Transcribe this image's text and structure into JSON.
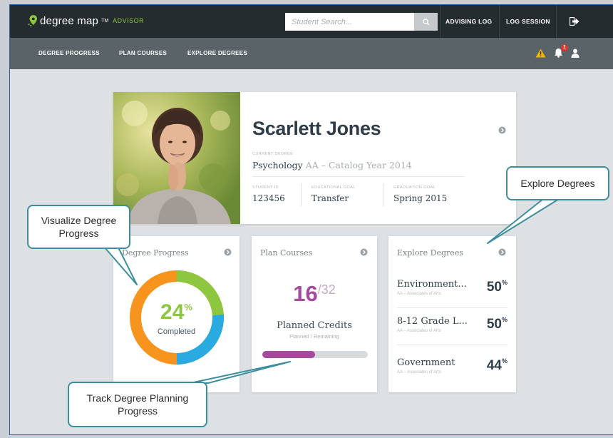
{
  "app": {
    "brand": "degree map",
    "tm": "TM",
    "edition": "ADVISOR"
  },
  "search": {
    "placeholder": "Student Search..."
  },
  "topnav": {
    "advising_log": "ADVISING LOG",
    "log_session": "LOG SESSION"
  },
  "subnav": {
    "items": [
      "DEGREE PROGRESS",
      "PLAN COURSES",
      "EXPLORE DEGREES"
    ],
    "notification_count": "1"
  },
  "student": {
    "name": "Scarlett Jones",
    "current_degree_label": "CURRENT DEGREE",
    "major": "Psychology",
    "degree_detail": "AA – Catalog Year 2014",
    "student_id_label": "STUDENT ID",
    "student_id": "123456",
    "goal_label": "EDUCATIONAL GOAL",
    "goal": "Transfer",
    "graduation_label": "GRADUATION GOAL",
    "graduation": "Spring 2015"
  },
  "degree_progress": {
    "title": "Degree Progress",
    "percent": "24",
    "percent_sign": "%",
    "percent_value": 0.24,
    "label": "Completed"
  },
  "plan_courses": {
    "title": "Plan Courses",
    "planned": "16",
    "total": "/32",
    "label": "Planned Credits",
    "sublabel": "Planned / Remaining",
    "fill_fraction": 0.5
  },
  "explore_degrees": {
    "title": "Explore Degrees",
    "items": [
      {
        "name": "Environment...",
        "sub": "AA – Associates of Arts",
        "pct": "50",
        "sign": "%"
      },
      {
        "name": "8-12 Grade L...",
        "sub": "AA – Associates of Arts",
        "pct": "50",
        "sign": "%"
      },
      {
        "name": "Government",
        "sub": "AA – Associates of Arts",
        "pct": "44",
        "sign": "%"
      }
    ]
  },
  "callouts": {
    "visualize": "Visualize Degree Progress",
    "explore": "Explore Degrees",
    "track": "Track Degree Planning Progress"
  },
  "colors": {
    "accent_green": "#8dc63f",
    "accent_purple": "#a64a9e",
    "donut_orange": "#f7941d",
    "donut_blue": "#29abe2",
    "topbar": "#252c30",
    "subnav": "#5a6368",
    "callout_border": "#3d8e9d"
  }
}
